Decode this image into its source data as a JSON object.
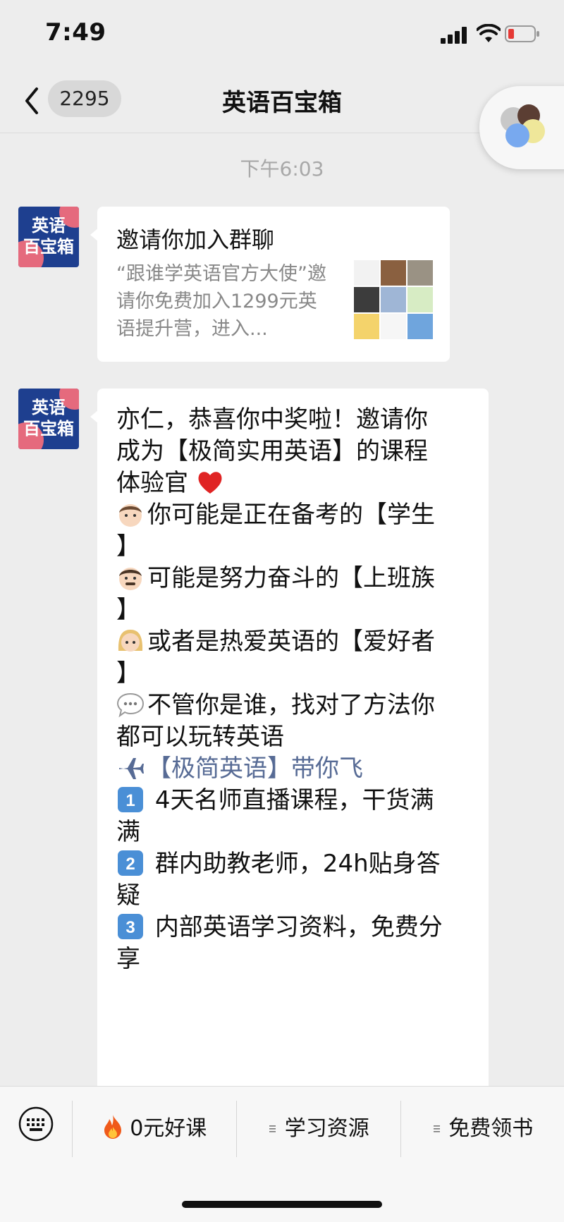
{
  "status_bar": {
    "time": "7:49"
  },
  "nav": {
    "unread_count": "2295",
    "title": "英语百宝箱"
  },
  "timestamp": "下午6:03",
  "avatar_text": [
    "英语",
    "百宝箱"
  ],
  "card": {
    "title": "邀请你加入群聊",
    "description": "“跟谁学英语官方大使”邀请你免费加入1299元英语提升营，进入..."
  },
  "message": {
    "lines": [
      "亦仁，恭喜你中奖啦！邀请你",
      "成为【极简实用英语】的课程",
      "体验官",
      "",
      "你可能是正在备考的【学生",
      "】",
      "可能是努力奋斗的【上班族",
      "】",
      "或者是热爱英语的【爱好者",
      "】",
      "",
      "不管你是谁，找对了方法你",
      "都可以玩转英语",
      "",
      "【极简英语】带你飞",
      "",
      "4天名师直播课程，干货满",
      "满",
      "群内助教老师，24h贴身答",
      "疑",
      "内部英语学习资料，免费分",
      "享"
    ]
  },
  "menu": {
    "items": [
      {
        "label": "0元好课",
        "icon": "fire-icon"
      },
      {
        "label": "学习资源",
        "icon": "menu-lines-icon"
      },
      {
        "label": "免费领书",
        "icon": "menu-lines-icon"
      }
    ]
  },
  "colors": {
    "background": "#ededed",
    "link": "#576b95",
    "avatar_blue": "#1e3f8f",
    "avatar_pink": "#e56a7d"
  }
}
